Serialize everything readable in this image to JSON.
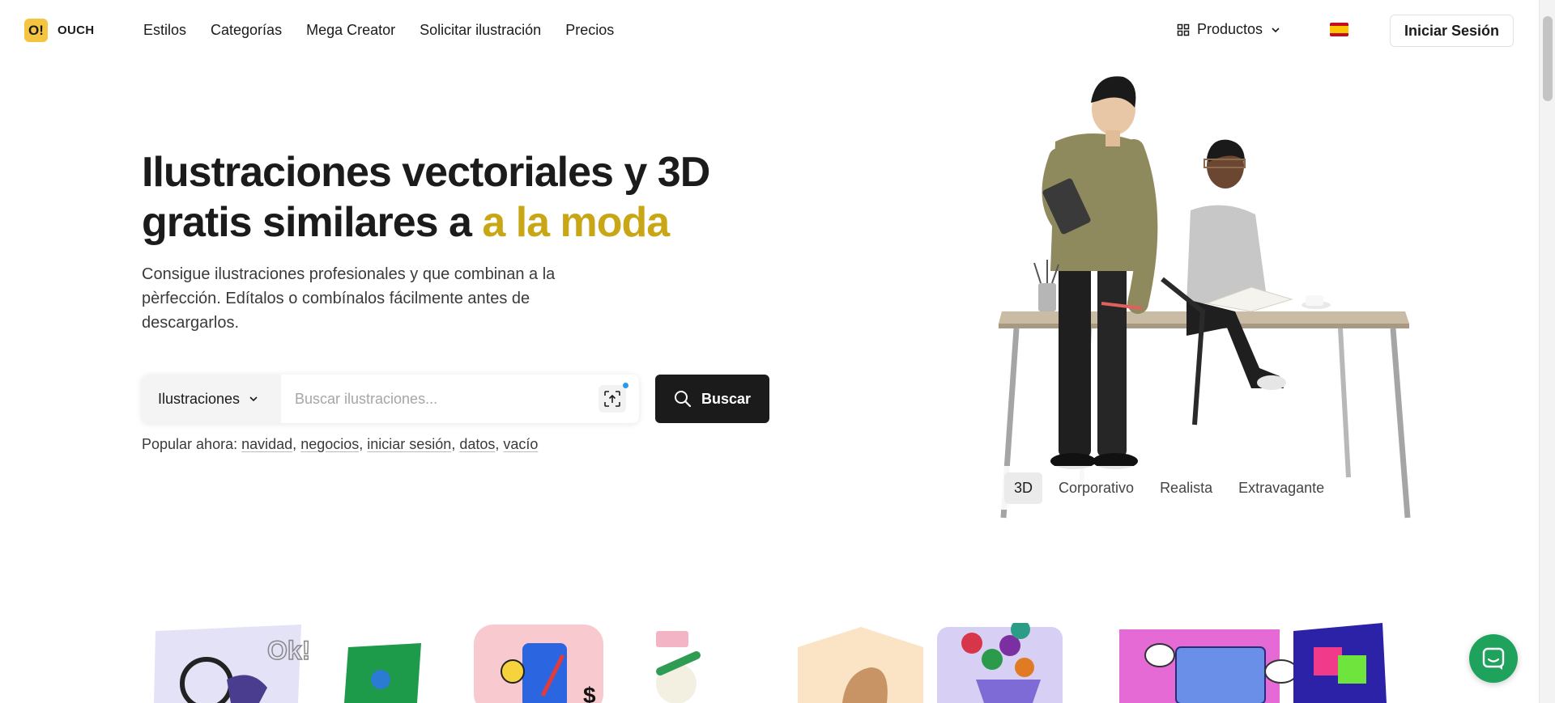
{
  "header": {
    "logo_mark": "O!",
    "logo_text": "OUCH",
    "nav": [
      "Estilos",
      "Categorías",
      "Mega Creator",
      "Solicitar ilustración",
      "Precios"
    ],
    "products_label": "Productos",
    "login_label": "Iniciar Sesión"
  },
  "hero": {
    "title_line1": "Ilustraciones vectoriales y 3D",
    "title_line2_prefix": "gratis similares a ",
    "title_accent": "a la moda",
    "subtitle": "Consigue ilustraciones profesionales y que combinan a la pèrfección. Edítalos o combínalos fácilmente antes de descargarlos."
  },
  "search": {
    "type_label": "Ilustraciones",
    "placeholder": "Buscar ilustraciones...",
    "button_label": "Buscar"
  },
  "popular": {
    "label": "Popular ahora:",
    "tags": [
      "navidad",
      "negocios",
      "iniciar sesión",
      "datos",
      "vacío"
    ]
  },
  "style_tabs": {
    "items": [
      "3D",
      "Corporativo",
      "Realista",
      "Extravagante"
    ],
    "active": "3D"
  },
  "colors": {
    "accent": "#c9a615",
    "logo": "#f5c542",
    "button_dark": "#1b1b1b",
    "chat": "#1fa35c"
  }
}
